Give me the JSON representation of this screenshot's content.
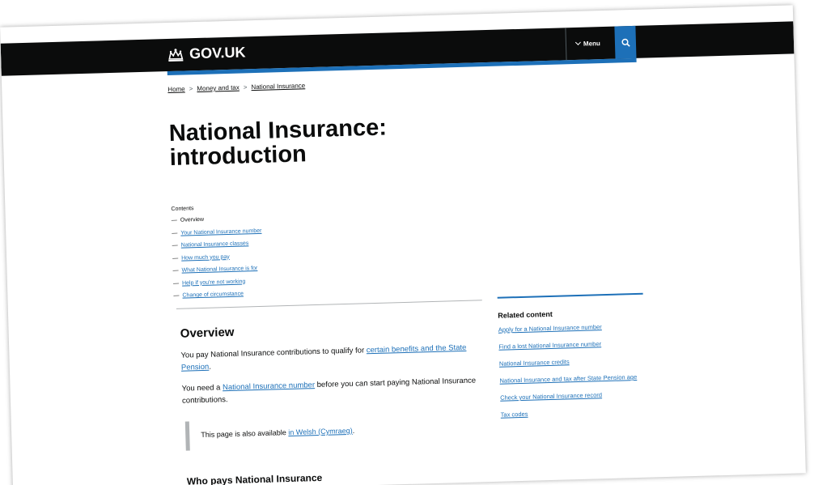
{
  "header": {
    "logo_text": "GOV.UK",
    "menu_label": "Menu",
    "search_icon": "search-icon",
    "crown_icon": "crown-icon"
  },
  "breadcrumb": {
    "items": [
      "Home",
      "Money and tax",
      "National Insurance"
    ],
    "separator": ">"
  },
  "page_title_line1": "National Insurance:",
  "page_title_line2": "introduction",
  "contents": {
    "heading": "Contents",
    "dash": "—",
    "items": [
      {
        "label": "Overview",
        "current": true
      },
      {
        "label": "Your National Insurance number"
      },
      {
        "label": "National Insurance classes"
      },
      {
        "label": "How much you pay"
      },
      {
        "label": "What National Insurance is for"
      },
      {
        "label": "Help if you're not working"
      },
      {
        "label": "Change of circumstance"
      }
    ]
  },
  "overview": {
    "heading": "Overview",
    "p1_text": "You pay National Insurance contributions to qualify for ",
    "p1_link": "certain benefits and the State Pension",
    "p1_end": ".",
    "p2_start": "You need a ",
    "p2_link": "National Insurance number",
    "p2_end": " before you can start paying National Insurance contributions."
  },
  "inset": {
    "text": "This page is also available ",
    "link": "in Welsh (Cymraeg)",
    "end": "."
  },
  "who_pays_heading": "Who pays National Insurance",
  "related": {
    "heading": "Related content",
    "items": [
      "Apply for a National Insurance number",
      "Find a lost National Insurance number",
      "National Insurance credits",
      "National Insurance and tax after State Pension age",
      "Check your National Insurance record",
      "Tax codes"
    ]
  },
  "colors": {
    "header_bg": "#0b0c0c",
    "brand_blue": "#1d70b8",
    "text": "#0b0c0c",
    "border_grey": "#b1b4b6"
  }
}
